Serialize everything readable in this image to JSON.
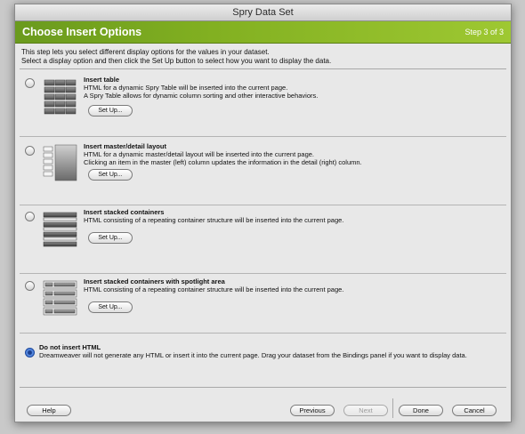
{
  "window": {
    "title": "Spry Data Set"
  },
  "header": {
    "title": "Choose Insert Options",
    "step": "Step 3 of 3"
  },
  "intro": [
    "This step lets you select different display options for the values in your dataset.",
    "Select a display option and then click the Set Up button to select how you want to display the data."
  ],
  "options": [
    {
      "title": "Insert table",
      "lines": [
        "HTML for a dynamic Spry Table will be inserted into the current page.",
        "A Spry Table allows for dynamic column sorting and other interactive behaviors."
      ],
      "button": "Set Up...",
      "selected": false,
      "icon": "table-layout-icon"
    },
    {
      "title": "Insert master/detail layout",
      "lines": [
        "HTML for a dynamic master/detail layout will be inserted into the current page.",
        "Clicking an item in the master (left) column updates the information in the detail (right) column."
      ],
      "button": "Set Up...",
      "selected": false,
      "icon": "master-detail-layout-icon"
    },
    {
      "title": "Insert stacked containers",
      "lines": [
        "HTML consisting of a repeating container structure will be inserted into the current page."
      ],
      "button": "Set Up...",
      "selected": false,
      "icon": "stacked-containers-icon"
    },
    {
      "title": "Insert stacked containers with spotlight area",
      "lines": [
        "HTML consisting of a repeating container structure will be inserted into the current page."
      ],
      "button": "Set Up...",
      "selected": false,
      "icon": "spotlight-containers-icon"
    },
    {
      "title": "Do not insert HTML",
      "lines": [
        "Dreamweaver will not generate any HTML or insert it into the current page. Drag your dataset from the Bindings panel if you want to display data."
      ],
      "selected": true
    }
  ],
  "footer": {
    "help": "Help",
    "previous": "Previous",
    "next": "Next",
    "done": "Done",
    "cancel": "Cancel"
  },
  "colors": {
    "header_green": "#82b021",
    "radio_selected": "#2c62c8"
  }
}
